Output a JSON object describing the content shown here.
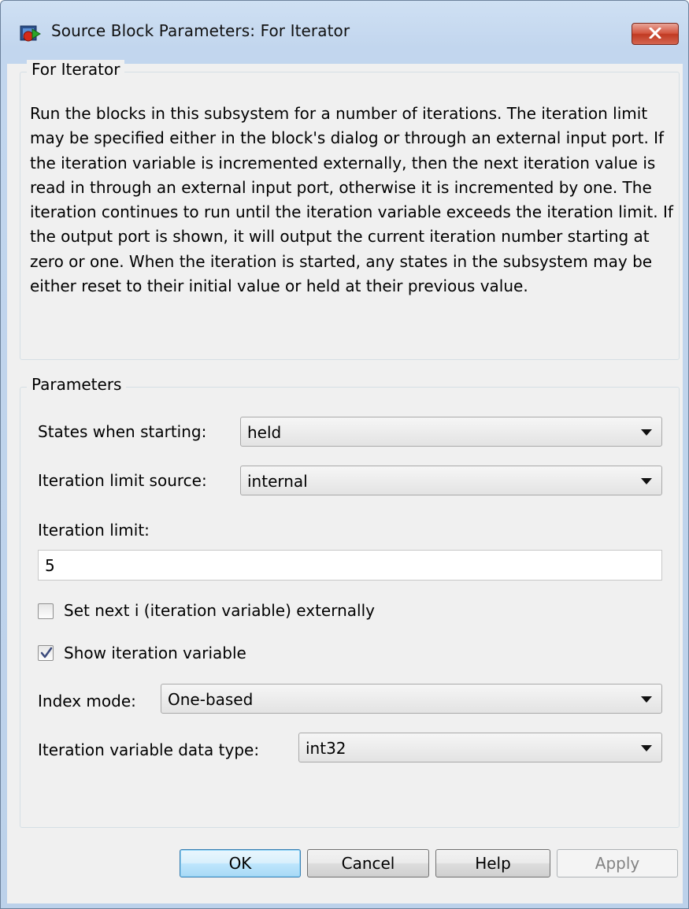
{
  "window": {
    "title": "Source Block Parameters: For Iterator",
    "icon": "simulink-block-icon",
    "close_icon": "close-x-icon"
  },
  "description_group": {
    "label": "For Iterator",
    "text": "Run the blocks in this subsystem for a number of iterations.  The iteration limit may be specified either in the block's dialog or through an external input port.  If the iteration variable is incremented externally, then the next iteration value is read in through an external input port, otherwise it is incremented by one.  The iteration continues to run until the iteration variable exceeds the iteration limit.  If the output port is shown, it will output the current iteration number starting at zero or one.  When the iteration is started, any states in the subsystem may be either reset to their initial value or held at their previous value."
  },
  "parameters": {
    "label": "Parameters",
    "states_when_starting": {
      "label": "States when starting:",
      "value": "held"
    },
    "iteration_limit_source": {
      "label": "Iteration limit source:",
      "value": "internal"
    },
    "iteration_limit": {
      "label": "Iteration limit:",
      "value": "5"
    },
    "set_next_i": {
      "label": "Set next i (iteration variable) externally",
      "checked": false
    },
    "show_iteration_variable": {
      "label": "Show iteration variable",
      "checked": true
    },
    "index_mode": {
      "label": "Index mode:",
      "value": "One-based"
    },
    "iteration_variable_data_type": {
      "label": "Iteration variable data type:",
      "value": "int32"
    }
  },
  "buttons": {
    "ok": "OK",
    "cancel": "Cancel",
    "help": "Help",
    "apply": "Apply"
  },
  "colors": {
    "titlebar": "#c2d6ee",
    "dialog_background": "#f0f0f0",
    "close_button": "#c8422a",
    "default_button": "#bee6fd"
  }
}
